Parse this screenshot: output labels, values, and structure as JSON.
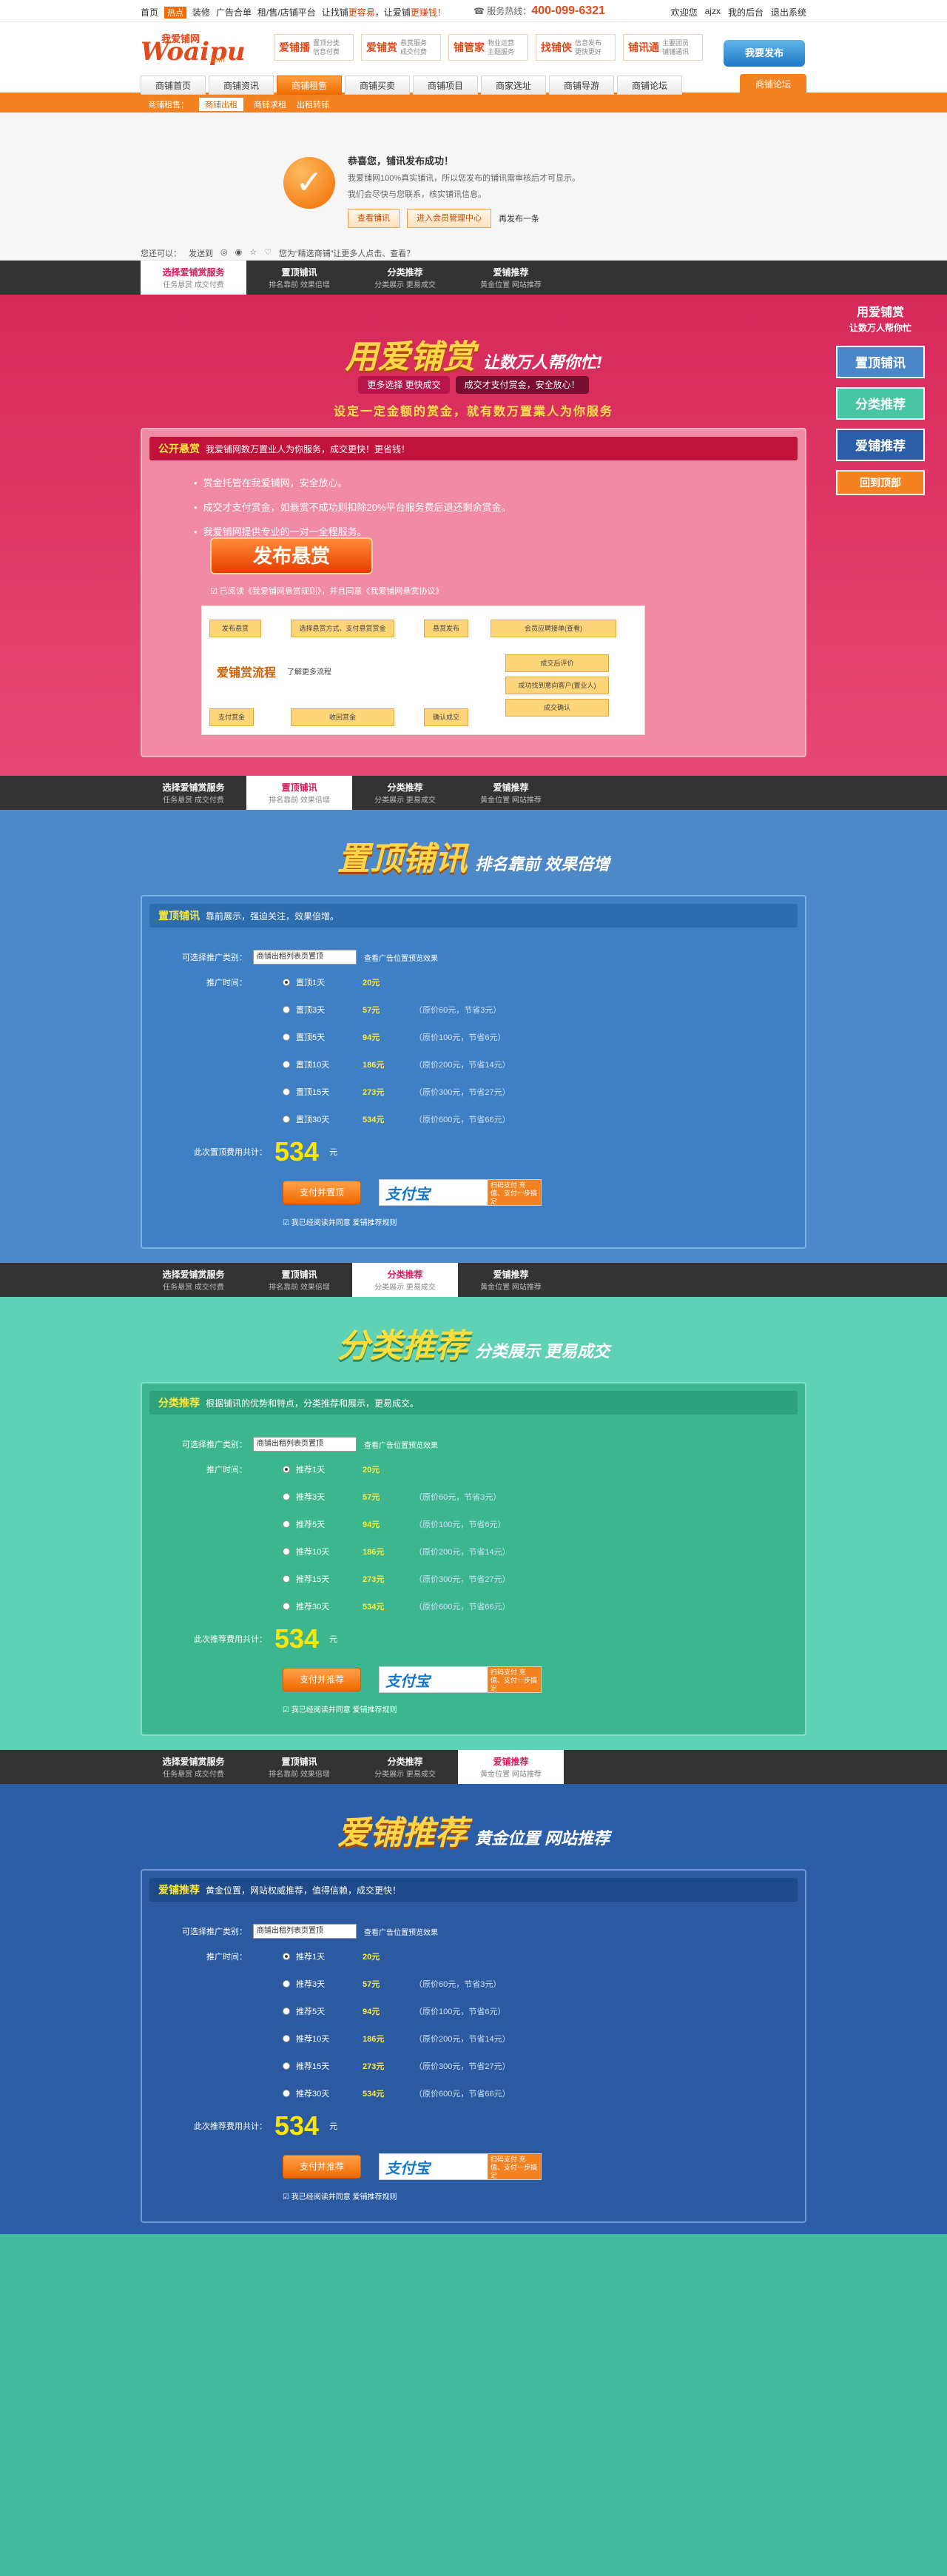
{
  "topbar": {
    "home": "首页",
    "hot": "热点",
    "items": [
      "装修",
      "广告合单",
      "租/售/店铺平台"
    ],
    "slogan": "让找铺",
    "slogan_red": "更容易",
    "slogan2": "，让爱铺",
    "slogan_red2": "更赚钱！",
    "hotline_label": "服务热线：",
    "hotline": "400-099-6321",
    "welcome": "欢迎您",
    "user": "ajzx",
    "backend": "我的后台",
    "logout": "退出系统"
  },
  "logo": {
    "cn": "我爱铺网",
    "en": "Woaipu",
    "com": ".com"
  },
  "products": [
    {
      "name": "爱铺播",
      "d1": "置顶分类",
      "d2": "信息付费"
    },
    {
      "name": "爱铺赏",
      "d1": "悬赏服务",
      "d2": "成交付费"
    },
    {
      "name": "铺管家",
      "d1": "物业运营",
      "d2": "主题服务"
    },
    {
      "name": "找铺侠",
      "d1": "信息发布",
      "d2": "更快更好"
    },
    {
      "name": "铺讯通",
      "d1": "主要团员",
      "d2": "铺铺通讯"
    }
  ],
  "corner_btn": "我要发布",
  "nav": {
    "items": [
      "商铺首页",
      "商铺资讯",
      "商铺租售",
      "商铺买卖",
      "商铺项目",
      "商家选址",
      "商铺导游",
      "商铺论坛"
    ],
    "forum": "商铺论坛",
    "active": 2
  },
  "subnav": {
    "label": "商铺租售：",
    "items": [
      "商铺出租",
      "商铺求租",
      "出租转铺"
    ],
    "active": 0
  },
  "success": {
    "title": "恭喜您，铺讯发布成功！",
    "line1": "我爱铺网100%真实铺讯，所以您发布的铺讯需审核后才可显示。",
    "line2": "我们会尽快与您联系，核实铺讯信息。",
    "btn1": "查看铺讯",
    "btn2": "进入会员管理中心",
    "btn3": "再发布一条"
  },
  "share": {
    "label": "您还可以：",
    "items": [
      "发送到",
      "关注",
      "收藏",
      "推荐",
      "分享",
      "点赞",
      "评论"
    ],
    "text": "您为“精选商铺”让更多人点击、查看？"
  },
  "tabs": [
    {
      "title": "选择爱铺赏服务",
      "sub": "任务悬赏  成交付费"
    },
    {
      "title": "置顶铺讯",
      "sub": "排名靠前  效果倍增"
    },
    {
      "title": "分类推荐",
      "sub": "分类展示  更易成交"
    },
    {
      "title": "爱铺推荐",
      "sub": "黄金位置  网站推荐"
    }
  ],
  "red": {
    "headline": "用爱铺赏",
    "headline2": "让数万人帮你忙!",
    "tag1": "更多选择  更快成交",
    "tag2": "成交才支付赏金，安全放心！",
    "subtitle": "设定一定金额的赏金，就有数万置業人为你服务",
    "panel_title": "公开悬赏",
    "panel_desc": "我爱铺网数万置业人为你服务，成交更快！更省钱！",
    "list": [
      "赏金托管在我爱铺网，安全放心。",
      "成交才支付赏金，如悬赏不成功则扣除20%平台服务费后退还剩余赏金。",
      "我爱铺网提供专业的一对一全程服务。"
    ],
    "publish": "发布悬赏",
    "agree": "已阅读《我爱铺网悬赏规则》，并且同意《我爱铺网悬赏协议》",
    "flow_title": "爱铺赏流程",
    "flow_sub": "了解更多流程",
    "flow_boxes": [
      "发布悬赏",
      "选择悬赏方式、支付悬赏赏金",
      "悬赏发布",
      "会员应聘接单(查看)",
      "成交后评价",
      "支付赏金",
      "成功找到意向客户(置业人)",
      "成交确认",
      "确认成交",
      "收回赏金"
    ],
    "side_top": "用爱铺赏",
    "side_top2": "让数万人帮你忙",
    "side": [
      "置顶铺讯",
      "分类推荐",
      "爱铺推荐",
      "回到顶部"
    ]
  },
  "top": {
    "headline": "置顶铺讯",
    "headline2": "排名靠前  效果倍增",
    "panel_title": "置顶铺讯",
    "panel_desc": "靠前展示，强迫关注，效果倍增。",
    "type_label": "可选择推广类别：",
    "type_value": "商铺出租列表页置顶",
    "type_note": "查看广告位置预览效果",
    "time_label": "推广时间：",
    "options": [
      {
        "name": "置顶1天",
        "price": "20元",
        "desc": ""
      },
      {
        "name": "置顶3天",
        "price": "57元",
        "desc": "（原价60元，节省3元）"
      },
      {
        "name": "置顶5天",
        "price": "94元",
        "desc": "（原价100元，节省6元）"
      },
      {
        "name": "置顶10天",
        "price": "186元",
        "desc": "（原价200元，节省14元）"
      },
      {
        "name": "置顶15天",
        "price": "273元",
        "desc": "（原价300元，节省27元）"
      },
      {
        "name": "置顶30天",
        "price": "534元",
        "desc": "（原价600元，节省66元）"
      }
    ],
    "total_label": "此次置顶费用共计：",
    "total": "534",
    "unit": "元",
    "pay": "支付并置顶",
    "alipay": "支付宝",
    "scan": "扫码支付  充值、支付一步搞定",
    "agree": "我已经阅读并同意  爱铺推荐规则"
  },
  "cat": {
    "headline": "分类推荐",
    "headline2": "分类展示  更易成交",
    "panel_title": "分类推荐",
    "panel_desc": "根据铺讯的优势和特点，分类推荐和展示，更易成交。",
    "type_label": "可选择推广类别：",
    "type_value": "商铺出租列表页置顶",
    "type_note": "查看广告位置预览效果",
    "time_label": "推广时间：",
    "options": [
      {
        "name": "推荐1天",
        "price": "20元",
        "desc": ""
      },
      {
        "name": "推荐3天",
        "price": "57元",
        "desc": "（原价60元，节省3元）"
      },
      {
        "name": "推荐5天",
        "price": "94元",
        "desc": "（原价100元，节省6元）"
      },
      {
        "name": "推荐10天",
        "price": "186元",
        "desc": "（原价200元，节省14元）"
      },
      {
        "name": "推荐15天",
        "price": "273元",
        "desc": "（原价300元，节省27元）"
      },
      {
        "name": "推荐30天",
        "price": "534元",
        "desc": "（原价600元，节省66元）"
      }
    ],
    "total_label": "此次推荐费用共计：",
    "total": "534",
    "unit": "元",
    "pay": "支付并推荐",
    "alipay": "支付宝",
    "scan": "扫码支付  充值、支付一步搞定",
    "agree": "我已经阅读并同意  爱铺推荐规则"
  },
  "rec": {
    "headline": "爱铺推荐",
    "headline2": "黄金位置  网站推荐",
    "panel_title": "爱铺推荐",
    "panel_desc": "黄金位置，网站权威推荐，值得信赖，成交更快！",
    "type_label": "可选择推广类别：",
    "type_value": "商铺出租列表页置顶",
    "type_note": "查看广告位置预览效果",
    "time_label": "推广时间：",
    "options": [
      {
        "name": "推荐1天",
        "price": "20元",
        "desc": ""
      },
      {
        "name": "推荐3天",
        "price": "57元",
        "desc": "（原价60元，节省3元）"
      },
      {
        "name": "推荐5天",
        "price": "94元",
        "desc": "（原价100元，节省6元）"
      },
      {
        "name": "推荐10天",
        "price": "186元",
        "desc": "（原价200元，节省14元）"
      },
      {
        "name": "推荐15天",
        "price": "273元",
        "desc": "（原价300元，节省27元）"
      },
      {
        "name": "推荐30天",
        "price": "534元",
        "desc": "（原价600元，节省66元）"
      }
    ],
    "total_label": "此次推荐费用共计：",
    "total": "534",
    "unit": "元",
    "pay": "支付并推荐",
    "alipay": "支付宝",
    "scan": "扫码支付  充值、支付一步搞定",
    "agree": "我已经阅读并同意  爱铺推荐规则"
  }
}
